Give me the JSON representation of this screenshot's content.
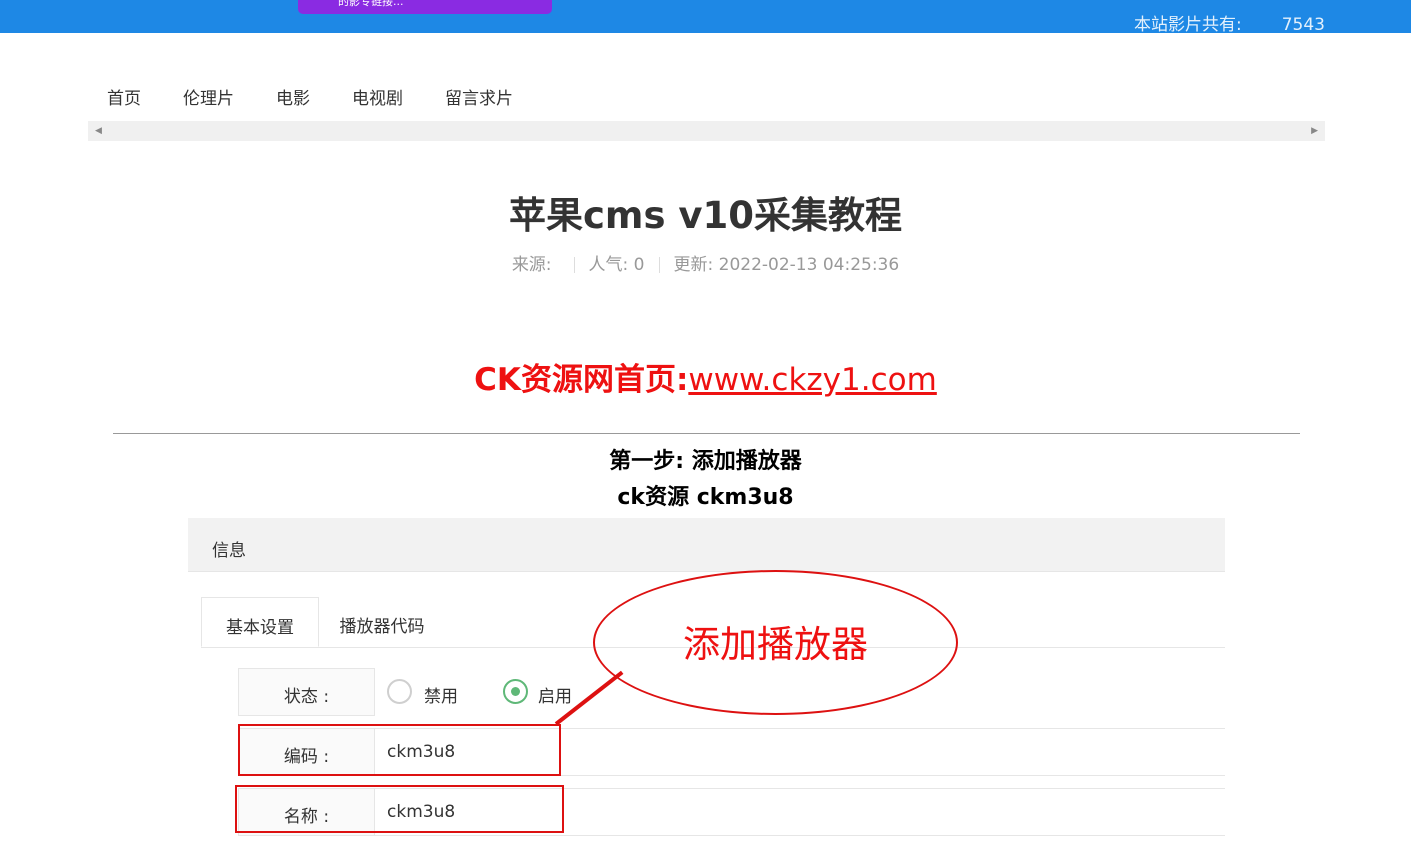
{
  "header": {
    "promo_text": "的影专链接...",
    "count_label": "本站影片共有:",
    "count_value": "7543"
  },
  "nav": {
    "items": [
      "首页",
      "伦理片",
      "电影",
      "电视剧",
      "留言求片"
    ]
  },
  "article": {
    "title": "苹果cms v10采集教程",
    "source_label": "来源:",
    "popularity": "人气: 0",
    "updated": "更新: 2022-02-13 04:25:36",
    "homepage_label": "CK资源网首页:",
    "homepage_link": "www.ckzy1.com",
    "step_title": "第一步: 添加播放器",
    "step_subtitle": "ck资源 ckm3u8"
  },
  "screenshot": {
    "panel_title": "信息",
    "tabs": [
      "基本设置",
      "播放器代码"
    ],
    "status_label": "状态 :",
    "status_options": [
      "禁用",
      "启用"
    ],
    "status_selected": "启用",
    "code_label": "编码 :",
    "code_value": "ckm3u8",
    "name_label": "名称 :",
    "name_value": "ckm3u8",
    "annotation": "添加播放器"
  },
  "colors": {
    "topbar": "#1e88e5",
    "promo": "#8a2be2",
    "annotation_red": "#dd1111",
    "radio_on": "#5fb878"
  }
}
